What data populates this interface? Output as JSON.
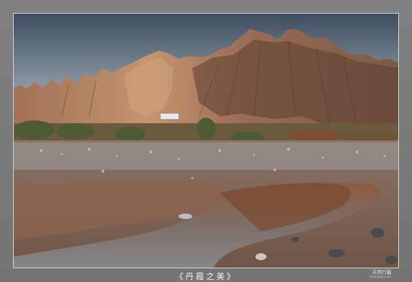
{
  "photo": {
    "description_id": "danxia-landscape",
    "colors": {
      "sky_top": "#4f5c6d",
      "sky_bottom": "#a9b2ba",
      "rock_light": "#b98a66",
      "rock_dark": "#5a3d2f",
      "riverbed": "#8a6a58",
      "water": "#7f7f86"
    }
  },
  "caption": {
    "title": "《丹霞之美》"
  },
  "signature": {
    "name": "天然行摄",
    "sub": "Cmdnature.com"
  }
}
